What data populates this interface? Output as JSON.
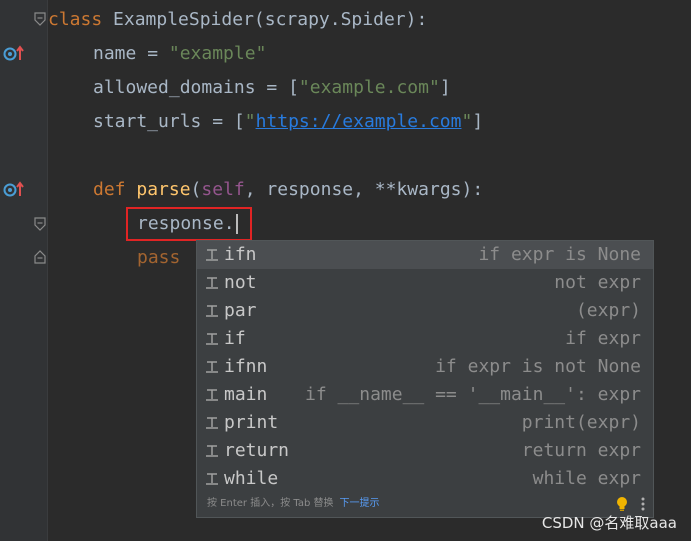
{
  "editor": {
    "lines": {
      "class_kw": "class",
      "class_name": " ExampleSpider(scrapy.Spider):",
      "name_var": "name",
      "eq": " = ",
      "name_val": "\"example\"",
      "domains_var": "allowed_domains",
      "domains_open": " = [",
      "domains_val": "\"example.com\"",
      "domains_close": "]",
      "urls_var": "start_urls",
      "urls_open": " = [",
      "urls_q1": "\"",
      "urls_val": "https://example.com",
      "urls_q2": "\"",
      "urls_close": "]",
      "def_kw": "def",
      "func_name": "parse",
      "paren_open": "(",
      "self_kw": "self",
      "params": ", response, **kwargs):",
      "typed_text": "response.",
      "pass_kw": "pass"
    }
  },
  "completion": {
    "items": [
      {
        "label": "ifn",
        "desc": "if expr is None"
      },
      {
        "label": "not",
        "desc": "not expr"
      },
      {
        "label": "par",
        "desc": "(expr)"
      },
      {
        "label": "if",
        "desc": "if expr"
      },
      {
        "label": "ifnn",
        "desc": "if expr is not None"
      },
      {
        "label": "main",
        "desc": "if __name__ == '__main__': expr"
      },
      {
        "label": "print",
        "desc": "print(expr)"
      },
      {
        "label": "return",
        "desc": "return expr"
      },
      {
        "label": "while",
        "desc": "while expr"
      }
    ],
    "footer_text": "按 Enter 插入，按 Tab 替换",
    "footer_link": "下一提示"
  },
  "watermark": "CSDN @名难取aaa",
  "colors": {
    "background": "#2b2b2b",
    "keyword": "#cc7832",
    "string": "#6a8759",
    "function": "#ffc66d",
    "highlight_border": "#e02424"
  }
}
